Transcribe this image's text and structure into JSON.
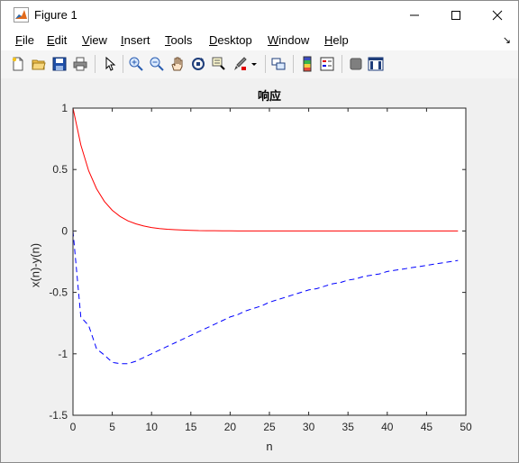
{
  "window": {
    "title": "Figure 1",
    "app_icon": "matlab-logo-icon",
    "controls": [
      "minimize-icon",
      "maximize-icon",
      "close-icon"
    ]
  },
  "menubar": {
    "items": [
      {
        "u": "F",
        "rest": "ile"
      },
      {
        "u": "E",
        "rest": "dit"
      },
      {
        "u": "V",
        "rest": "iew"
      },
      {
        "u": "I",
        "rest": "nsert"
      },
      {
        "u": "T",
        "rest": "ools"
      },
      {
        "u": "D",
        "rest": "esktop"
      },
      {
        "u": "W",
        "rest": "indow"
      },
      {
        "u": "H",
        "rest": "elp"
      }
    ],
    "overflow_icon": "menu-arrow-icon",
    "overflow_glyph": "↘"
  },
  "toolbar": {
    "buttons": [
      "new-figure-icon",
      "open-file-icon",
      "save-icon",
      "print-icon",
      "pointer-icon",
      "zoom-in-icon",
      "zoom-out-icon",
      "pan-icon",
      "rotate-3d-icon",
      "data-cursor-icon",
      "brush-icon",
      "link-plot-icon",
      "colorbar-icon",
      "legend-icon",
      "hide-plot-tools-icon",
      "show-plot-tools-icon"
    ]
  },
  "chart_data": {
    "type": "line",
    "title": "响应",
    "xlabel": "n",
    "ylabel": "x(n)-y(n)",
    "xlim": [
      0,
      50
    ],
    "ylim": [
      -1.5,
      1
    ],
    "xticks": [
      0,
      5,
      10,
      15,
      20,
      25,
      30,
      35,
      40,
      45,
      50
    ],
    "yticks": [
      1,
      0.5,
      0,
      -0.5,
      -1,
      -1.5
    ],
    "grid": false,
    "series": [
      {
        "style": "solid",
        "color": "#ff0000",
        "x": [
          0,
          1,
          2,
          3,
          4,
          5,
          6,
          7,
          8,
          9,
          10,
          11,
          12,
          13,
          14,
          15,
          16,
          17,
          18,
          19,
          20,
          21,
          22,
          23,
          24,
          25,
          26,
          27,
          28,
          29,
          30,
          31,
          32,
          33,
          34,
          35,
          36,
          37,
          38,
          39,
          40,
          41,
          42,
          43,
          44,
          45,
          46,
          47,
          48,
          49
        ],
        "y": [
          1.0,
          0.7,
          0.49,
          0.343,
          0.24,
          0.168,
          0.118,
          0.082,
          0.058,
          0.04,
          0.028,
          0.02,
          0.014,
          0.01,
          0.007,
          0.005,
          0.003,
          0.002,
          0.002,
          0.001,
          0.001,
          0,
          0,
          0,
          0,
          0,
          0,
          0,
          0,
          0,
          0,
          0,
          0,
          0,
          0,
          0,
          0,
          0,
          0,
          0,
          0,
          0,
          0,
          0,
          0,
          0,
          0,
          0,
          0,
          0
        ]
      },
      {
        "style": "dashed",
        "color": "#0000ff",
        "x": [
          0,
          1,
          2,
          3,
          4,
          5,
          6,
          7,
          8,
          9,
          10,
          11,
          12,
          13,
          14,
          15,
          16,
          17,
          18,
          19,
          20,
          21,
          22,
          23,
          24,
          25,
          26,
          27,
          28,
          29,
          30,
          31,
          32,
          33,
          34,
          35,
          36,
          37,
          38,
          39,
          40,
          41,
          42,
          43,
          44,
          45,
          46,
          47,
          48,
          49
        ],
        "y": [
          0,
          -0.7,
          -0.77,
          -0.96,
          -1.01,
          -1.07,
          -1.08,
          -1.08,
          -1.06,
          -1.03,
          -1.0,
          -0.97,
          -0.94,
          -0.91,
          -0.88,
          -0.85,
          -0.82,
          -0.79,
          -0.76,
          -0.73,
          -0.7,
          -0.68,
          -0.65,
          -0.63,
          -0.61,
          -0.58,
          -0.56,
          -0.54,
          -0.52,
          -0.5,
          -0.48,
          -0.47,
          -0.45,
          -0.43,
          -0.42,
          -0.4,
          -0.39,
          -0.37,
          -0.36,
          -0.35,
          -0.33,
          -0.32,
          -0.31,
          -0.3,
          -0.29,
          -0.28,
          -0.27,
          -0.26,
          -0.25,
          -0.24
        ]
      }
    ]
  }
}
